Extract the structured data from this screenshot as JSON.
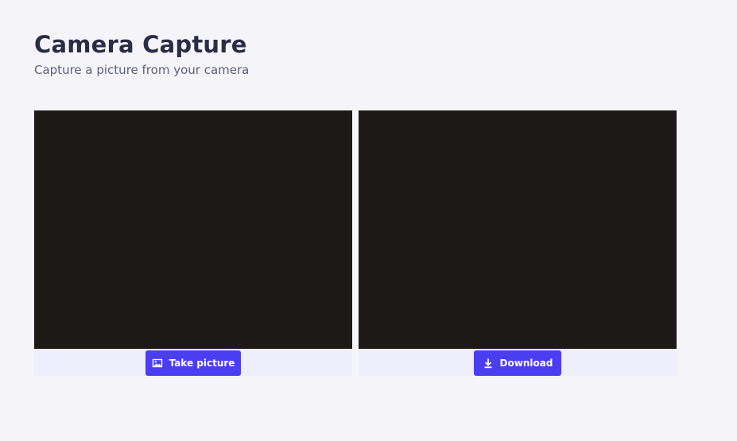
{
  "header": {
    "title": "Camera Capture",
    "subtitle": "Capture a picture from your camera"
  },
  "camera_panel": {
    "button_label": "Take picture",
    "button_icon": "image-icon"
  },
  "capture_panel": {
    "button_label": "Download",
    "button_icon": "download-icon"
  },
  "colors": {
    "background": "#f5f5f9",
    "accent": "#4a3ef0",
    "viewport": "#1c1917",
    "button_bar": "#eeeefd",
    "title_text": "#2b2d47"
  }
}
